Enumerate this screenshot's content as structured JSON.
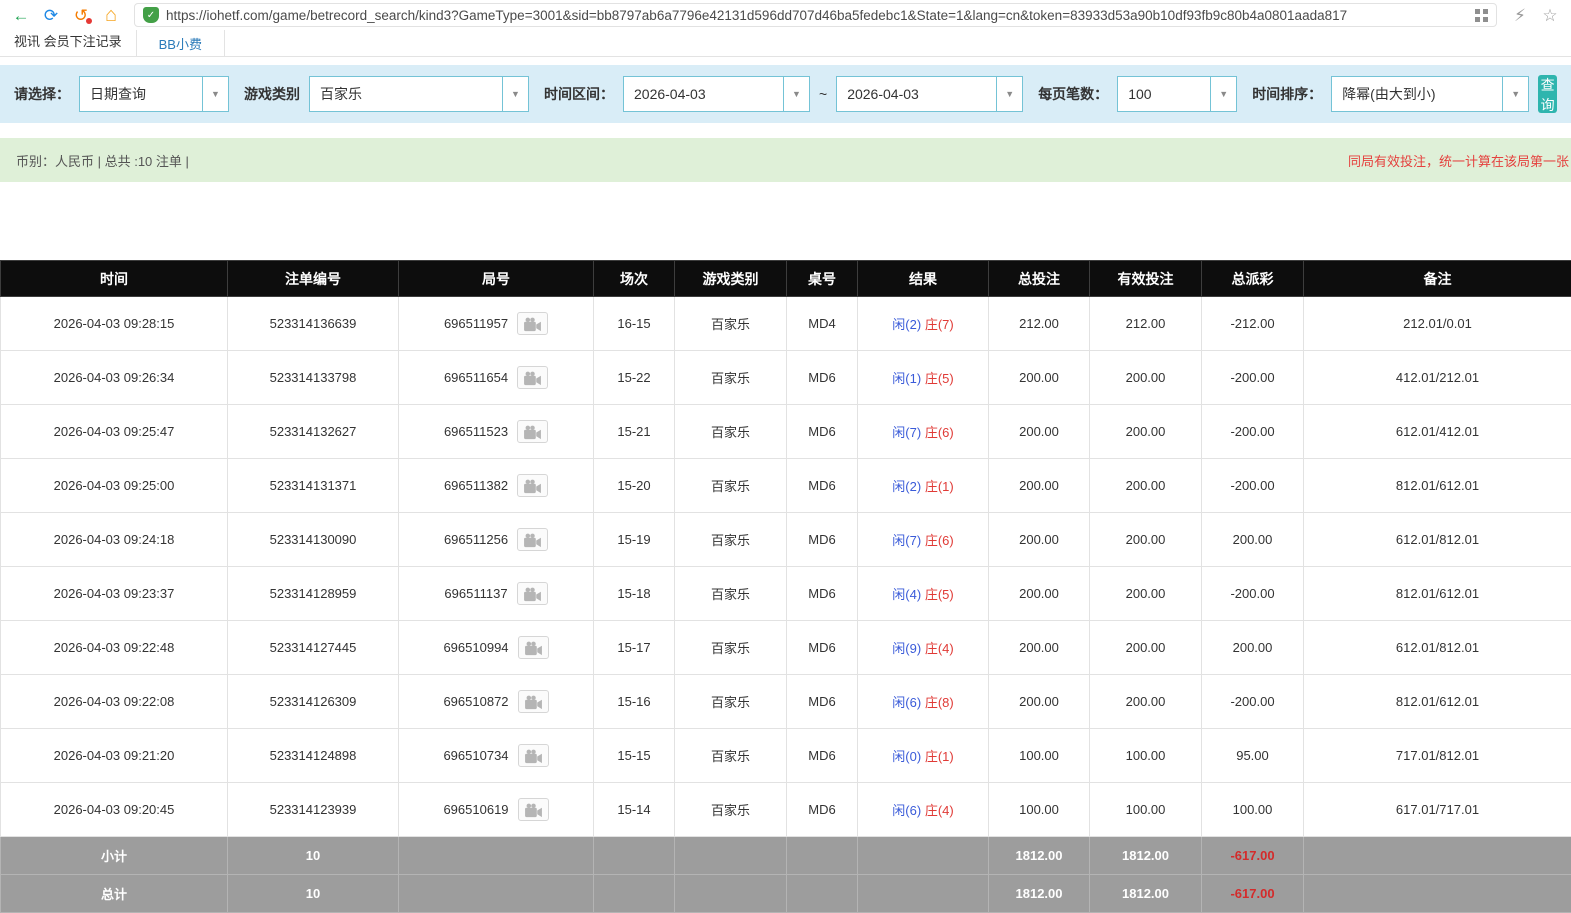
{
  "icons": {
    "back": "←",
    "refresh": "⟳",
    "undo": "↺",
    "home": "⌂",
    "shield_check": "✓",
    "flash": "⚡",
    "star": "☆",
    "caret": "▼"
  },
  "browser": {
    "url": "https://iohetf.com/game/betrecord_search/kind3?GameType=3001&sid=bb8797ab6a7796e42131d596dd707d46ba5fedebc1&State=1&lang=cn&token=83933d53a90b10df93fb9c80b4a0801aada817"
  },
  "nav": {
    "breadcrumb": "视讯 会员下注记录",
    "tab": "BB小费"
  },
  "filters": {
    "label_select": "请选择：",
    "query_type": "日期查询",
    "label_game": "游戏类别",
    "game": "百家乐",
    "label_range": "时间区间：",
    "date_from": "2026-04-03",
    "range_sep": "~",
    "date_to": "2026-04-03",
    "label_page_size": "每页笔数：",
    "page_size": "100",
    "label_sort": "时间排序：",
    "sort": "降幂(由大到小)",
    "search": "查询"
  },
  "summary": {
    "info": "币别：人民币 | 总共 :10 注单 |",
    "notice": "同局有效投注，统一计算在该局第一张"
  },
  "table": {
    "headers": [
      "时间",
      "注单编号",
      "局号",
      "场次",
      "游戏类别",
      "桌号",
      "结果",
      "总投注",
      "有效投注",
      "总派彩",
      "备注"
    ],
    "rows": [
      {
        "time": "2026-04-03 09:28:15",
        "bet_id": "523314136639",
        "round": "696511957",
        "session": "16-15",
        "game": "百家乐",
        "table": "MD4",
        "player": "闲(2)",
        "banker": "庄(7)",
        "total_bet": "212.00",
        "valid_bet": "212.00",
        "payout": "-212.00",
        "remark": "212.01/0.01"
      },
      {
        "time": "2026-04-03 09:26:34",
        "bet_id": "523314133798",
        "round": "696511654",
        "session": "15-22",
        "game": "百家乐",
        "table": "MD6",
        "player": "闲(1)",
        "banker": "庄(5)",
        "total_bet": "200.00",
        "valid_bet": "200.00",
        "payout": "-200.00",
        "remark": "412.01/212.01"
      },
      {
        "time": "2026-04-03 09:25:47",
        "bet_id": "523314132627",
        "round": "696511523",
        "session": "15-21",
        "game": "百家乐",
        "table": "MD6",
        "player": "闲(7)",
        "banker": "庄(6)",
        "total_bet": "200.00",
        "valid_bet": "200.00",
        "payout": "-200.00",
        "remark": "612.01/412.01"
      },
      {
        "time": "2026-04-03 09:25:00",
        "bet_id": "523314131371",
        "round": "696511382",
        "session": "15-20",
        "game": "百家乐",
        "table": "MD6",
        "player": "闲(2)",
        "banker": "庄(1)",
        "total_bet": "200.00",
        "valid_bet": "200.00",
        "payout": "-200.00",
        "remark": "812.01/612.01"
      },
      {
        "time": "2026-04-03 09:24:18",
        "bet_id": "523314130090",
        "round": "696511256",
        "session": "15-19",
        "game": "百家乐",
        "table": "MD6",
        "player": "闲(7)",
        "banker": "庄(6)",
        "total_bet": "200.00",
        "valid_bet": "200.00",
        "payout": "200.00",
        "remark": "612.01/812.01"
      },
      {
        "time": "2026-04-03 09:23:37",
        "bet_id": "523314128959",
        "round": "696511137",
        "session": "15-18",
        "game": "百家乐",
        "table": "MD6",
        "player": "闲(4)",
        "banker": "庄(5)",
        "total_bet": "200.00",
        "valid_bet": "200.00",
        "payout": "-200.00",
        "remark": "812.01/612.01"
      },
      {
        "time": "2026-04-03 09:22:48",
        "bet_id": "523314127445",
        "round": "696510994",
        "session": "15-17",
        "game": "百家乐",
        "table": "MD6",
        "player": "闲(9)",
        "banker": "庄(4)",
        "total_bet": "200.00",
        "valid_bet": "200.00",
        "payout": "200.00",
        "remark": "612.01/812.01"
      },
      {
        "time": "2026-04-03 09:22:08",
        "bet_id": "523314126309",
        "round": "696510872",
        "session": "15-16",
        "game": "百家乐",
        "table": "MD6",
        "player": "闲(6)",
        "banker": "庄(8)",
        "total_bet": "200.00",
        "valid_bet": "200.00",
        "payout": "-200.00",
        "remark": "812.01/612.01"
      },
      {
        "time": "2026-04-03 09:21:20",
        "bet_id": "523314124898",
        "round": "696510734",
        "session": "15-15",
        "game": "百家乐",
        "table": "MD6",
        "player": "闲(0)",
        "banker": "庄(1)",
        "total_bet": "100.00",
        "valid_bet": "100.00",
        "payout": "95.00",
        "remark": "717.01/812.01"
      },
      {
        "time": "2026-04-03 09:20:45",
        "bet_id": "523314123939",
        "round": "696510619",
        "session": "15-14",
        "game": "百家乐",
        "table": "MD6",
        "player": "闲(6)",
        "banker": "庄(4)",
        "total_bet": "100.00",
        "valid_bet": "100.00",
        "payout": "100.00",
        "remark": "617.01/717.01"
      }
    ],
    "subtotal": {
      "label": "小计",
      "count": "10",
      "total_bet": "1812.00",
      "valid_bet": "1812.00",
      "payout": "-617.00"
    },
    "total": {
      "label": "总计",
      "count": "10",
      "total_bet": "1812.00",
      "valid_bet": "1812.00",
      "payout": "-617.00"
    }
  }
}
